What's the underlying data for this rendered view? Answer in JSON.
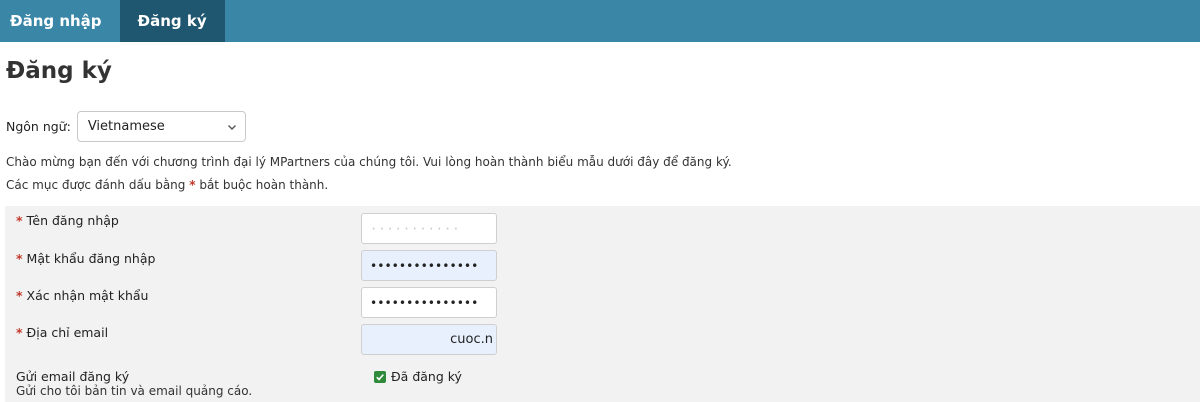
{
  "nav": {
    "tabs": [
      {
        "label": "Đăng nhập"
      },
      {
        "label": "Đăng ký"
      }
    ]
  },
  "page": {
    "title": "Đăng ký"
  },
  "language": {
    "label": "Ngôn ngữ:",
    "selected": "Vietnamese"
  },
  "intro": {
    "line1": "Chào mừng bạn đến với chương trình đại lý MPartners của chúng tôi. Vui lòng hoàn thành biểu mẫu dưới đây để đăng ký.",
    "line2_before": "Các mục được đánh dấu bằng ",
    "line2_star": "*",
    "line2_after": " bắt buộc hoàn thành."
  },
  "form": {
    "required_marker": "*",
    "username": {
      "label": "Tên đăng nhập",
      "value": "···········"
    },
    "password": {
      "label": "Mật khẩu đăng nhập",
      "value": "•••••••••••••••"
    },
    "confirm": {
      "label": "Xác nhận mật khẩu",
      "value": "•••••••••••••••"
    },
    "email": {
      "label": "Địa chỉ email",
      "value": "cuoc.n"
    },
    "newsletter": {
      "label": "Gửi email đăng ký",
      "description": "Gửi cho tôi bản tin và email quảng cáo.",
      "checkbox_label": "Đã đăng ký",
      "checked": true
    }
  },
  "colors": {
    "nav": "#3a86a7",
    "nav_active": "#1f5670",
    "required": "#c0392b",
    "autofill": "#e8f0fe",
    "checkbox": "#2f8a3a"
  }
}
